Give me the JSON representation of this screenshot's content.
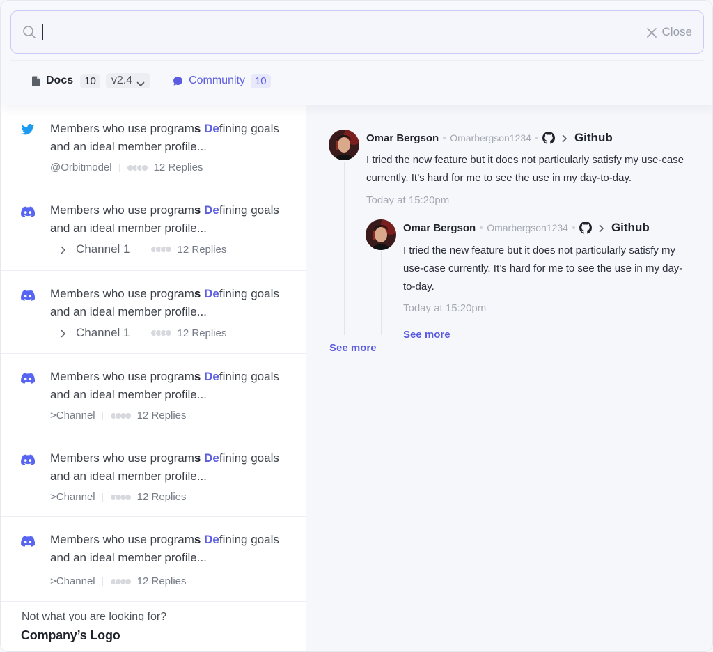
{
  "search": {
    "value": "",
    "placeholder": "",
    "close_label": "Close"
  },
  "tabs": {
    "docs": {
      "label": "Docs",
      "count": "10",
      "version": "v2.4"
    },
    "community": {
      "label": "Community",
      "count": "10"
    }
  },
  "results": [
    {
      "source": "twitter-icon",
      "title_pre": "Members who use program",
      "title_mid": "s ",
      "title_hl": "De",
      "title_post": "fining goals and an ideal member profile...",
      "meta_label": "@Orbitmodel",
      "replies": "12 Replies"
    },
    {
      "source": "discord-icon",
      "title_pre": "Members who use program",
      "title_mid": "s ",
      "title_hl": "De",
      "title_post": "fining goals and an ideal member profile...",
      "meta_label": "Channel 1",
      "replies": "12 Replies"
    },
    {
      "source": "discord-icon",
      "title_pre": "Members who use program",
      "title_mid": "s ",
      "title_hl": "De",
      "title_post": "fining goals and an ideal member profile...",
      "meta_label": "Channel 1",
      "replies": "12 Replies"
    },
    {
      "source": "discord-icon",
      "title_pre": "Members who use program",
      "title_mid": "s ",
      "title_hl": "De",
      "title_post": "fining goals and an ideal member profile...",
      "meta_label": ">Channel",
      "replies": "12 Replies"
    },
    {
      "source": "discord-icon",
      "title_pre": "Members who use program",
      "title_mid": "s ",
      "title_hl": "De",
      "title_post": "fining goals and an ideal member profile...",
      "meta_label": ">Channel",
      "replies": "12 Replies"
    },
    {
      "source": "discord-icon",
      "title_pre": "Members who use program",
      "title_mid": "s ",
      "title_hl": "De",
      "title_post": "fining goals and an ideal member profile...",
      "meta_label": ">Channel",
      "replies": "12 Replies"
    }
  ],
  "footer": {
    "question": "Not what you are looking for?",
    "logo": "Company’s Logo"
  },
  "thread": {
    "post": {
      "name": "Omar Bergson",
      "handle": "Omarbergson1234",
      "source": "Github",
      "text": "I tried the new feature but it does not particularly satisfy my use-case currently. It’s hard for me to see the use in my day-to-day.",
      "time": "Today at 15:20pm",
      "see_more": "See more"
    },
    "reply": {
      "name": "Omar Bergson",
      "handle": "Omarbergson1234",
      "source": "Github",
      "text": "I tried the new feature but it does not particularly satisfy my use-case currently. It’s hard for me to see the use in my day-to-day.",
      "time": "Today at 15:20pm",
      "see_more": "See more"
    }
  },
  "colors": {
    "accent": "#5b5ce0",
    "twitter": "#1d9bf0",
    "discord": "#5865f2",
    "border": "#c9cdf6"
  }
}
